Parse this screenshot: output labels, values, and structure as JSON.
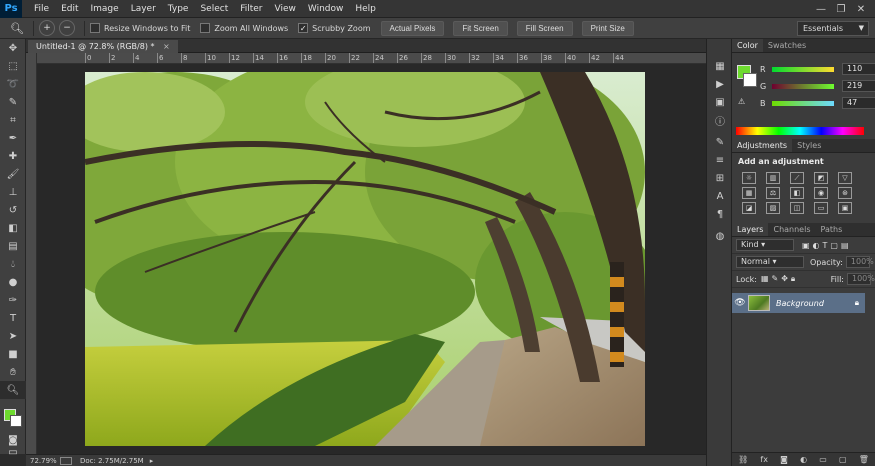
{
  "app": {
    "logo": "Ps"
  },
  "menu": [
    "File",
    "Edit",
    "Image",
    "Layer",
    "Type",
    "Select",
    "Filter",
    "View",
    "Window",
    "Help"
  ],
  "window_controls": {
    "minimize": "—",
    "restore": "❐",
    "close": "✕"
  },
  "options": {
    "tool_icon": "zoom-icon",
    "zoom_in": "+",
    "zoom_out": "−",
    "resize_windows": {
      "label": "Resize Windows to Fit",
      "checked": false
    },
    "zoom_all": {
      "label": "Zoom All Windows",
      "checked": false
    },
    "scrubby": {
      "label": "Scrubby Zoom",
      "checked": true
    },
    "buttons": {
      "actual": "Actual Pixels",
      "fit": "Fit Screen",
      "fill": "Fill Screen",
      "print": "Print Size"
    },
    "workspace": "Essentials"
  },
  "document": {
    "tab_title": "Untitled-1 @ 72.8% (RGB/8) *",
    "tab_close": "×",
    "ruler_labels": [
      "0",
      "2",
      "4",
      "6",
      "8",
      "10",
      "12",
      "14",
      "16",
      "18",
      "20",
      "22",
      "24",
      "26",
      "28",
      "30",
      "32",
      "34",
      "36",
      "38",
      "40",
      "42",
      "44"
    ]
  },
  "status": {
    "zoom": "72.79%",
    "doc": "Doc: 2.75M/2.75M",
    "arrow": "▸"
  },
  "color_panel": {
    "tabs": [
      "Color",
      "Swatches"
    ],
    "r": {
      "label": "R",
      "value": "110"
    },
    "g": {
      "label": "G",
      "value": "219"
    },
    "b": {
      "label": "B",
      "value": "47"
    },
    "fg_hex": "#6edb2f"
  },
  "adjustments": {
    "tabs": [
      "Adjustments",
      "Styles"
    ],
    "title": "Add an adjustment"
  },
  "layers": {
    "tabs": [
      "Layers",
      "Channels",
      "Paths"
    ],
    "kind": "Kind",
    "blend": "Normal",
    "opacity_label": "Opacity:",
    "opacity_value": "100%",
    "lock_label": "Lock:",
    "fill_label": "Fill:",
    "fill_value": "100%",
    "layer_name": "Background"
  }
}
